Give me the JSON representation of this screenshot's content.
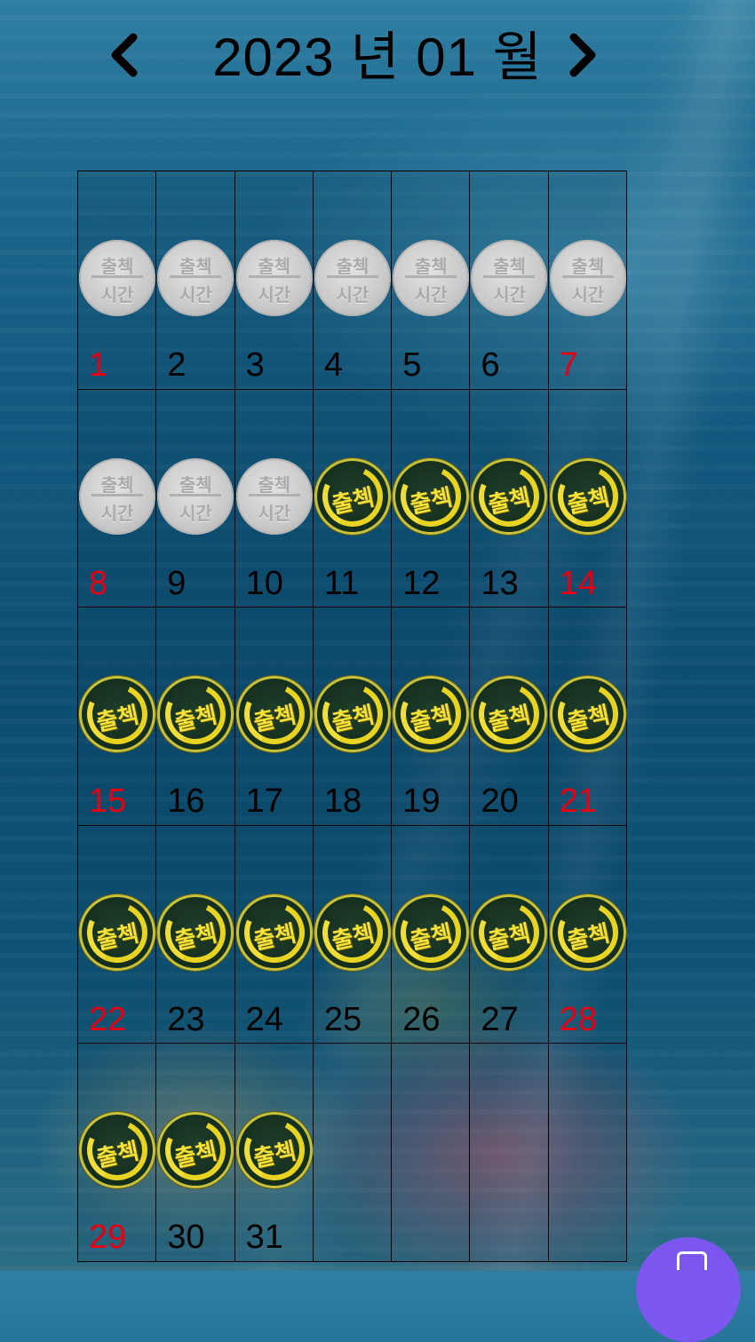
{
  "header": {
    "title": "2023 년 01 월",
    "prev_icon": "chevron-left-icon",
    "next_icon": "chevron-right-icon"
  },
  "calendar": {
    "stamp_types": {
      "gray": {
        "line1": "출첵",
        "line2": "시간"
      },
      "gold": {
        "word": "출첵"
      }
    },
    "colors": {
      "weekend": "#e60012",
      "weekday": "#000000"
    },
    "days": [
      {
        "label": "1",
        "stamp": "gray",
        "weekend": true
      },
      {
        "label": "2",
        "stamp": "gray",
        "weekend": false
      },
      {
        "label": "3",
        "stamp": "gray",
        "weekend": false
      },
      {
        "label": "4",
        "stamp": "gray",
        "weekend": false
      },
      {
        "label": "5",
        "stamp": "gray",
        "weekend": false
      },
      {
        "label": "6",
        "stamp": "gray",
        "weekend": false
      },
      {
        "label": "7",
        "stamp": "gray",
        "weekend": true
      },
      {
        "label": "8",
        "stamp": "gray",
        "weekend": true
      },
      {
        "label": "9",
        "stamp": "gray",
        "weekend": false
      },
      {
        "label": "10",
        "stamp": "gray",
        "weekend": false
      },
      {
        "label": "11",
        "stamp": "gold",
        "weekend": false
      },
      {
        "label": "12",
        "stamp": "gold",
        "weekend": false
      },
      {
        "label": "13",
        "stamp": "gold",
        "weekend": false
      },
      {
        "label": "14",
        "stamp": "gold",
        "weekend": true
      },
      {
        "label": "15",
        "stamp": "gold",
        "weekend": true
      },
      {
        "label": "16",
        "stamp": "gold",
        "weekend": false
      },
      {
        "label": "17",
        "stamp": "gold",
        "weekend": false
      },
      {
        "label": "18",
        "stamp": "gold",
        "weekend": false
      },
      {
        "label": "19",
        "stamp": "gold",
        "weekend": false
      },
      {
        "label": "20",
        "stamp": "gold",
        "weekend": false
      },
      {
        "label": "21",
        "stamp": "gold",
        "weekend": true
      },
      {
        "label": "22",
        "stamp": "gold",
        "weekend": true
      },
      {
        "label": "23",
        "stamp": "gold",
        "weekend": false
      },
      {
        "label": "24",
        "stamp": "gold",
        "weekend": false
      },
      {
        "label": "25",
        "stamp": "gold",
        "weekend": false
      },
      {
        "label": "26",
        "stamp": "gold",
        "weekend": false
      },
      {
        "label": "27",
        "stamp": "gold",
        "weekend": false
      },
      {
        "label": "28",
        "stamp": "gold",
        "weekend": true
      },
      {
        "label": "29",
        "stamp": "gold",
        "weekend": true
      },
      {
        "label": "30",
        "stamp": "gold",
        "weekend": false
      },
      {
        "label": "31",
        "stamp": "gold",
        "weekend": false
      },
      {
        "label": "",
        "stamp": "none",
        "weekend": false
      },
      {
        "label": "",
        "stamp": "none",
        "weekend": false
      },
      {
        "label": "",
        "stamp": "none",
        "weekend": false
      },
      {
        "label": "",
        "stamp": "none",
        "weekend": false
      }
    ]
  },
  "fab": {
    "icon": "chat-icon",
    "color": "#7b57f0"
  }
}
